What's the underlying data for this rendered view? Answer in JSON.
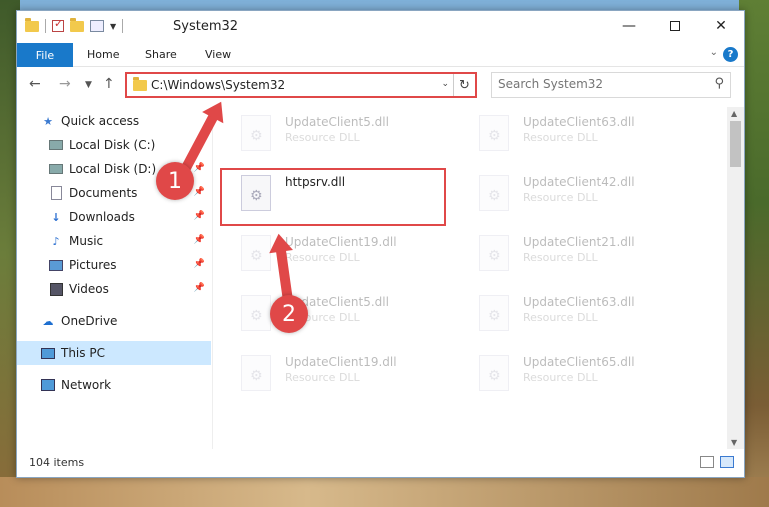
{
  "window": {
    "title": "System32",
    "min_glyph": "—",
    "close_glyph": "✕"
  },
  "ribbon": {
    "tabs": [
      {
        "label": "File"
      },
      {
        "label": "Home"
      },
      {
        "label": "Share"
      },
      {
        "label": "View"
      }
    ],
    "help_glyph": "?"
  },
  "address": {
    "path": "C:\\Windows\\System32",
    "search_placeholder": "Search System32"
  },
  "sidebar": {
    "items": [
      {
        "label": "Quick access",
        "icon": "star-icon"
      },
      {
        "label": "Local Disk (C:)",
        "icon": "drive-icon",
        "pinned": true
      },
      {
        "label": "Local Disk (D:)",
        "icon": "drive-icon",
        "pinned": true
      },
      {
        "label": "Documents",
        "icon": "documents-icon",
        "pinned": true
      },
      {
        "label": "Downloads",
        "icon": "downloads-icon",
        "pinned": true
      },
      {
        "label": "Music",
        "icon": "music-icon",
        "pinned": true
      },
      {
        "label": "Pictures",
        "icon": "pictures-icon",
        "pinned": true
      },
      {
        "label": "Videos",
        "icon": "videos-icon",
        "pinned": true
      },
      {
        "label": "OneDrive",
        "icon": "cloud-icon"
      },
      {
        "label": "This PC",
        "icon": "computer-icon",
        "selected": true
      },
      {
        "label": "Network",
        "icon": "network-icon"
      }
    ]
  },
  "files": {
    "left_column": [
      {
        "name": "UpdateClient5.dll",
        "type": "Resource DLL"
      },
      {
        "name": "httpsrv.dll",
        "type": ""
      },
      {
        "name": "UpdateClient19.dll",
        "type": "Resource DLL"
      },
      {
        "name": "UpdateClient5.dll",
        "type": "Resource DLL"
      },
      {
        "name": "UpdateClient19.dll",
        "type": "Resource DLL"
      }
    ],
    "right_column": [
      {
        "name": "UpdateClient63.dll",
        "type": "Resource DLL"
      },
      {
        "name": "UpdateClient42.dll",
        "type": "Resource DLL"
      },
      {
        "name": "UpdateClient21.dll",
        "type": "Resource DLL"
      },
      {
        "name": "UpdateClient63.dll",
        "type": "Resource DLL"
      },
      {
        "name": "UpdateClient65.dll",
        "type": "Resource DLL"
      }
    ]
  },
  "status": {
    "item_count": "104 items"
  },
  "annotations": {
    "step1": "1",
    "step2": "2",
    "color": "#e04848"
  },
  "colors": {
    "accent": "#1979ca",
    "selection": "#cce8ff"
  }
}
